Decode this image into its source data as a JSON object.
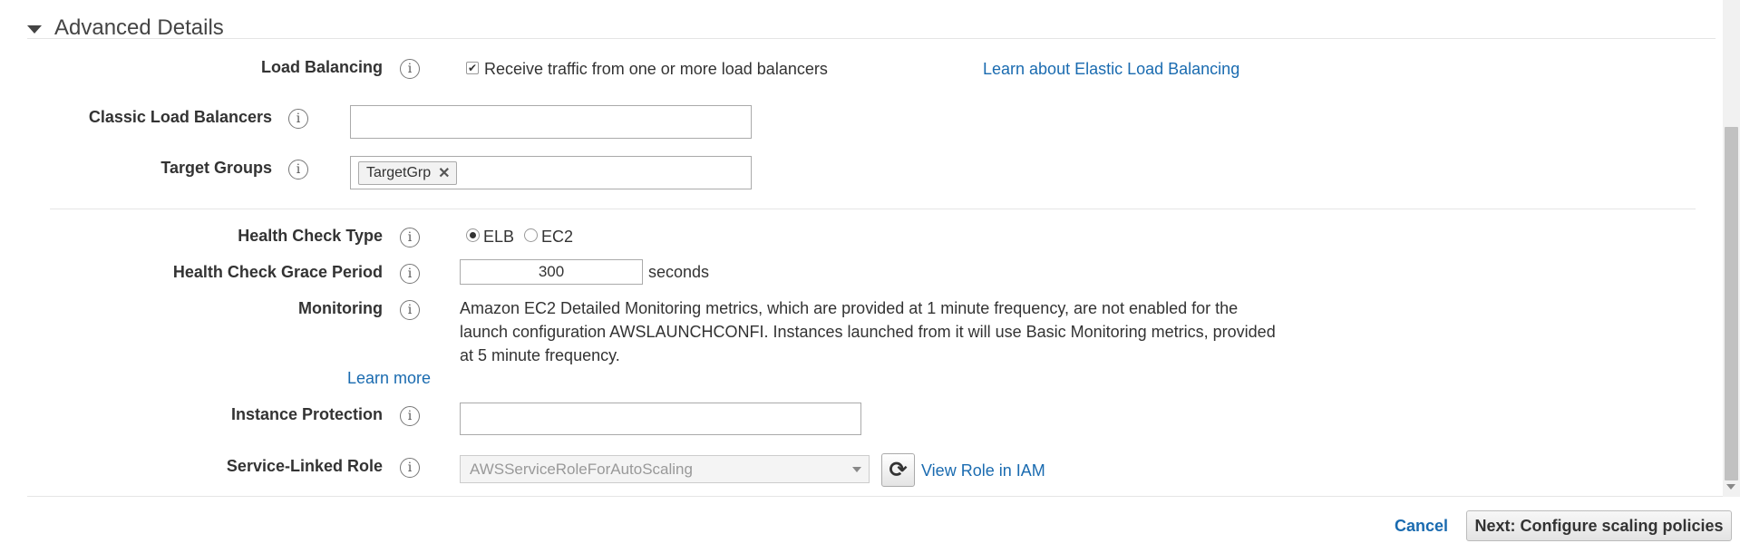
{
  "section": {
    "title": "Advanced Details"
  },
  "load_balancing": {
    "label": "Load Balancing",
    "checkbox_checked": true,
    "checkbox_label": "Receive traffic from one or more load balancers",
    "learn_link": "Learn about Elastic Load Balancing"
  },
  "classic_load_balancers": {
    "label": "Classic Load Balancers",
    "value": ""
  },
  "target_groups": {
    "label": "Target Groups",
    "tags": [
      "TargetGrp"
    ]
  },
  "health_check_type": {
    "label": "Health Check Type",
    "options": [
      "ELB",
      "EC2"
    ],
    "selected": "ELB"
  },
  "health_check_grace_period": {
    "label": "Health Check Grace Period",
    "value": "300",
    "unit": "seconds"
  },
  "monitoring": {
    "label": "Monitoring",
    "text": "Amazon EC2 Detailed Monitoring metrics, which are provided at 1 minute frequency, are not enabled for the launch configuration AWSLAUNCHCONFI. Instances launched from it will use Basic Monitoring metrics, provided at 5 minute frequency.",
    "learn_more": "Learn more"
  },
  "instance_protection": {
    "label": "Instance Protection",
    "value": ""
  },
  "service_linked_role": {
    "label": "Service-Linked Role",
    "selected": "AWSServiceRoleForAutoScaling",
    "view_link": "View Role in IAM"
  },
  "footer": {
    "cancel_label": "Cancel",
    "next_label": "Next: Configure scaling policies"
  },
  "colors": {
    "link": "#1a6bb0",
    "text": "#333333",
    "border": "#aaaaaa"
  },
  "icons": {
    "info": "info-icon",
    "collapse": "triangle-down-icon",
    "refresh": "refresh-icon",
    "remove_tag": "close-icon",
    "dropdown": "chevron-down-icon"
  }
}
